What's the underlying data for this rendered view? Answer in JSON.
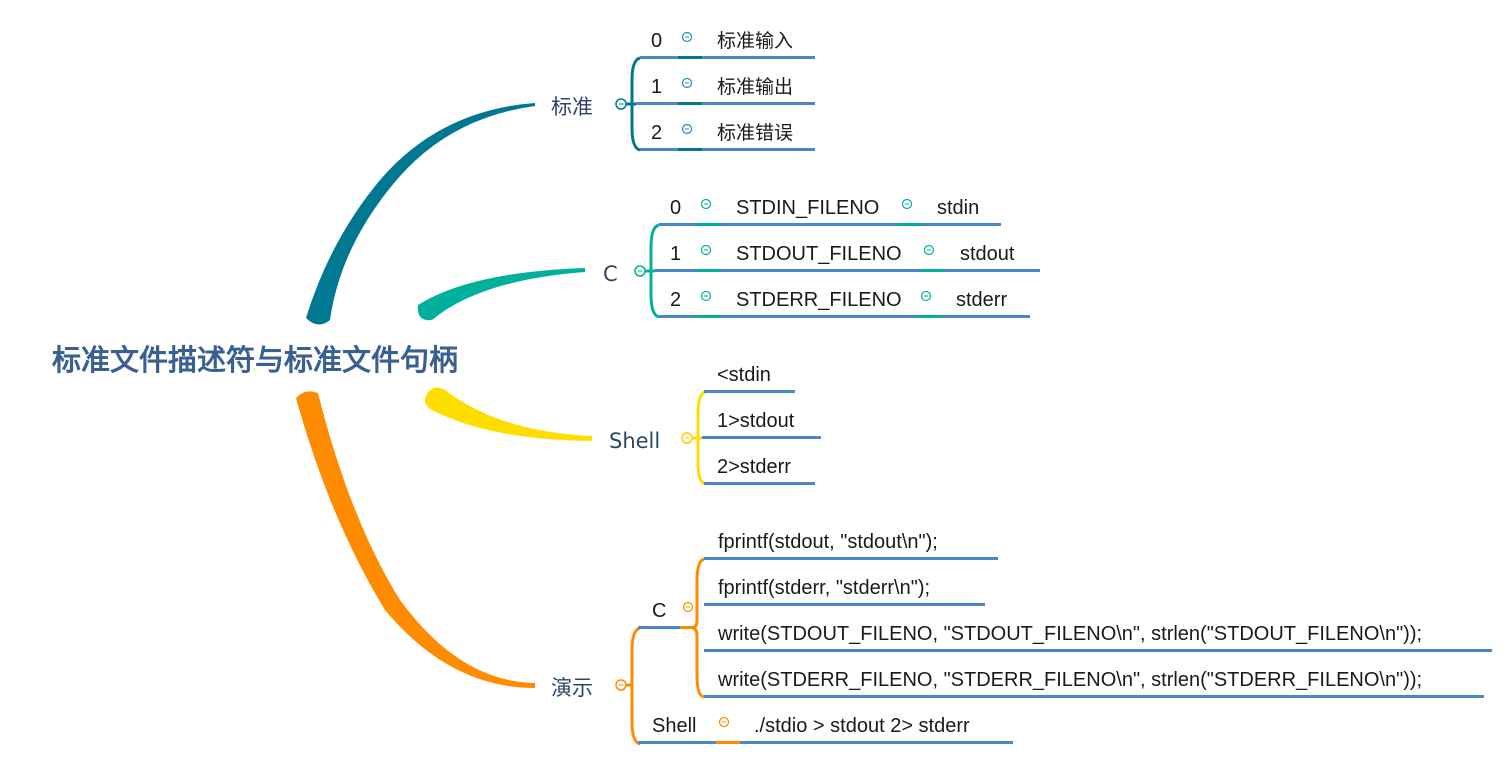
{
  "root": {
    "title": "标准文件描述符与标准文件句柄"
  },
  "colors": {
    "standard": "#007891",
    "c": "#00b09b",
    "shell": "#ffdd00",
    "demo": "#ff8c00",
    "underline": "#4a86c8",
    "text_dark": "#2b4766"
  },
  "branches": {
    "standard": {
      "label": "标准",
      "items": [
        {
          "fd": "0",
          "name": "标准输入"
        },
        {
          "fd": "1",
          "name": "标准输出"
        },
        {
          "fd": "2",
          "name": "标准错误"
        }
      ]
    },
    "c": {
      "label": "C",
      "items": [
        {
          "fd": "0",
          "macro": "STDIN_FILENO",
          "handle": "stdin"
        },
        {
          "fd": "1",
          "macro": "STDOUT_FILENO",
          "handle": "stdout"
        },
        {
          "fd": "2",
          "macro": "STDERR_FILENO",
          "handle": "stderr"
        }
      ]
    },
    "shell": {
      "label": "Shell",
      "items": [
        "<stdin",
        "1>stdout",
        "2>stderr"
      ]
    },
    "demo": {
      "label": "演示",
      "c": {
        "label": "C",
        "items": [
          "fprintf(stdout, \"stdout\\n\");",
          "fprintf(stderr, \"stderr\\n\");",
          "write(STDOUT_FILENO, \"STDOUT_FILENO\\n\", strlen(\"STDOUT_FILENO\\n\"));",
          "write(STDERR_FILENO, \"STDERR_FILENO\\n\", strlen(\"STDERR_FILENO\\n\"));"
        ]
      },
      "shell": {
        "label": "Shell",
        "command": "./stdio > stdout 2> stderr"
      }
    }
  }
}
